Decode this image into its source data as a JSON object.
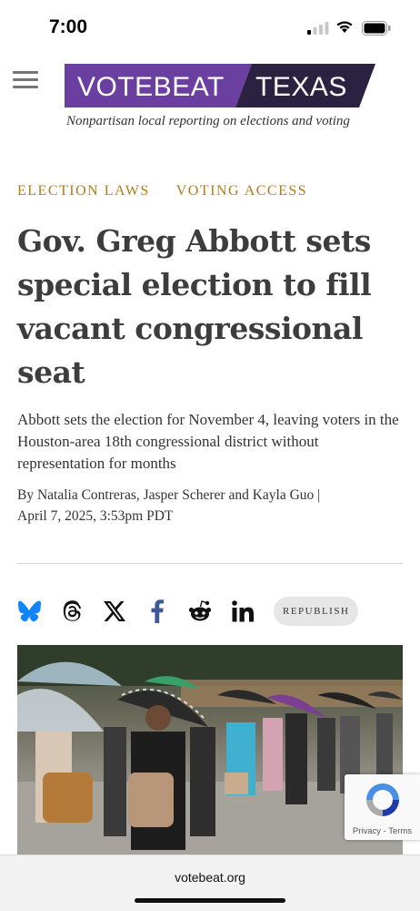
{
  "status_bar": {
    "time": "7:00"
  },
  "header": {
    "logo_left": "VOTEBEAT",
    "logo_right": "TEXAS",
    "tagline": "Nonpartisan local reporting on elections and voting",
    "colors": {
      "logo_purple": "#6b3fa0",
      "logo_dark": "#2b2140"
    }
  },
  "article": {
    "tags": [
      "ELECTION LAWS",
      "VOTING ACCESS"
    ],
    "tag_color": "#b07b1b",
    "headline_lines": [
      "Gov. Greg Abbott sets",
      "special election to fill",
      "vacant congressional",
      "seat"
    ],
    "dek": "Abbott sets the election for November 4, leaving voters in the Houston-area 18th congressional district without representation for months",
    "byline": {
      "prefix": "By",
      "authors": [
        "Natalia Contreras",
        "Jasper Scherer",
        "Kayla Guo"
      ],
      "sep1": ",",
      "sep2": "and",
      "date": "April 7, 2025, 3:53pm PDT"
    }
  },
  "share": {
    "icons": [
      "bluesky-icon",
      "threads-icon",
      "x-icon",
      "facebook-icon",
      "reddit-icon",
      "linkedin-icon"
    ],
    "republish_label": "REPUBLISH"
  },
  "recaptcha": {
    "label": "Privacy - Terms"
  },
  "browser": {
    "url": "votebeat.org"
  }
}
